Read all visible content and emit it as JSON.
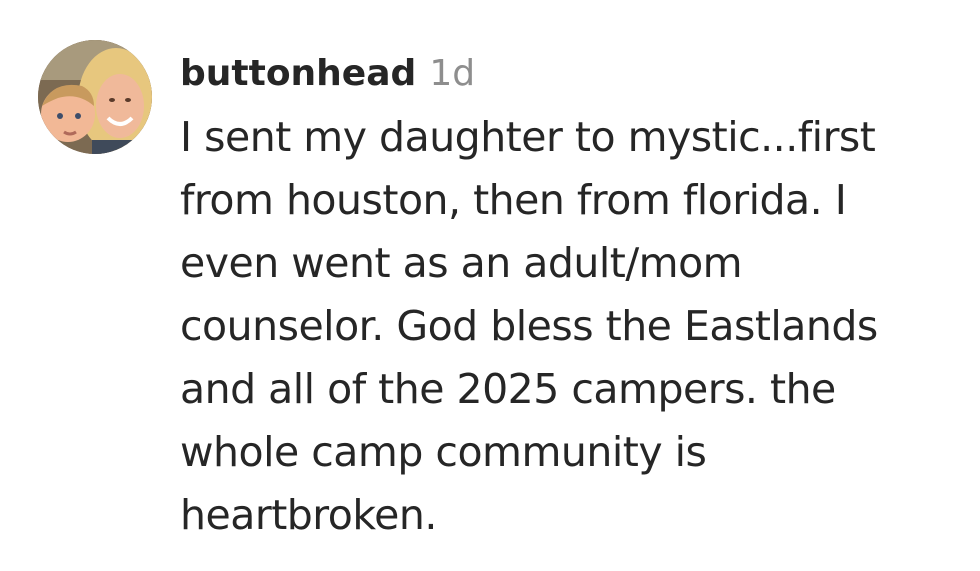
{
  "comment": {
    "username": "buttonhead",
    "timestamp": "1d",
    "avatar_icon": "profile-photo-icon",
    "text": "I sent my daughter to mystic...first\nfrom houston, then from florida. I\neven went as an adult/mom\ncounselor. God bless the Eastlands\nand all of the 2025 campers. the\nwhole camp community is\nheartbroken."
  }
}
